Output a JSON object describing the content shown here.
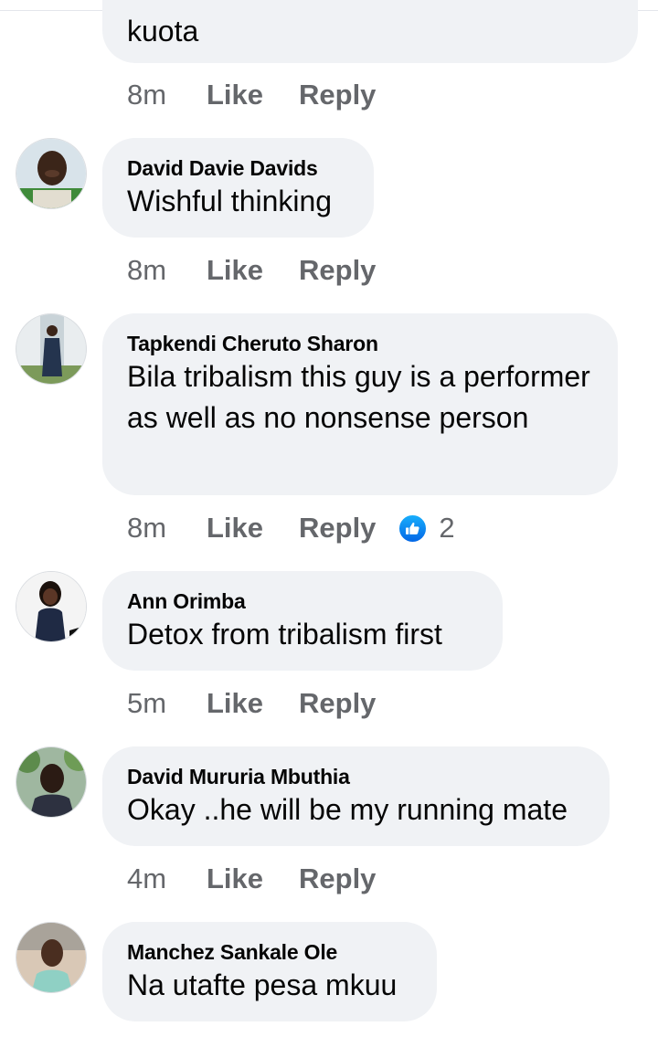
{
  "actions": {
    "like_label": "Like",
    "reply_label": "Reply"
  },
  "comments": [
    {
      "author": "",
      "text": "kuota",
      "time": "8m"
    },
    {
      "author": "David Davie Davids",
      "text": "Wishful thinking",
      "time": "8m"
    },
    {
      "author": "Tapkendi Cheruto Sharon",
      "text": "Bila  tribalism this guy is a performer as well as no nonsense person",
      "time": "8m",
      "reaction_icon": "like-reaction-icon",
      "reaction_count": "2"
    },
    {
      "author": "Ann Orimba",
      "text": "Detox from tribalism first",
      "time": "5m"
    },
    {
      "author": "David Mururia Mbuthia",
      "text": "Okay ..he will be my running mate",
      "time": "4m"
    },
    {
      "author": "Manchez Sankale Ole",
      "text": "Na utafte pesa mkuu"
    }
  ],
  "colors": {
    "bubble": "#f0f2f5",
    "meta_text": "#65676b",
    "like_blue": "#0571ed"
  }
}
